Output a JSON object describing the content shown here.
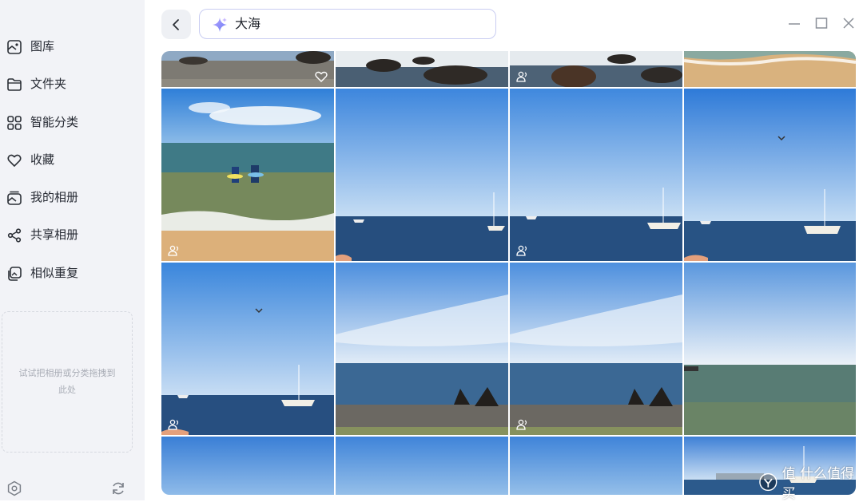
{
  "sidebar": {
    "items": [
      {
        "label": "图库",
        "icon": "gallery-icon"
      },
      {
        "label": "文件夹",
        "icon": "folder-icon"
      },
      {
        "label": "智能分类",
        "icon": "grid-icon"
      },
      {
        "label": "收藏",
        "icon": "heart-icon"
      },
      {
        "label": "我的相册",
        "icon": "album-icon"
      },
      {
        "label": "共享相册",
        "icon": "share-icon"
      },
      {
        "label": "相似重复",
        "icon": "duplicate-icon"
      }
    ],
    "dropzone_hint": "试试把相册或分类拖拽到此处",
    "bottom_icons": [
      "settings-icon",
      "sync-icon"
    ]
  },
  "search": {
    "query": "大海",
    "icon": "ai-sparkle-icon"
  },
  "window_controls": [
    "minimize-icon",
    "maximize-icon",
    "close-icon"
  ],
  "photos": {
    "count_visible": 16,
    "badges": "person-icon"
  },
  "watermark": {
    "text": "值 什么值得买"
  },
  "colors": {
    "accent": "#7b6cf6",
    "sidebar_bg": "#f2f3f7",
    "search_border": "#c9cdf2"
  }
}
